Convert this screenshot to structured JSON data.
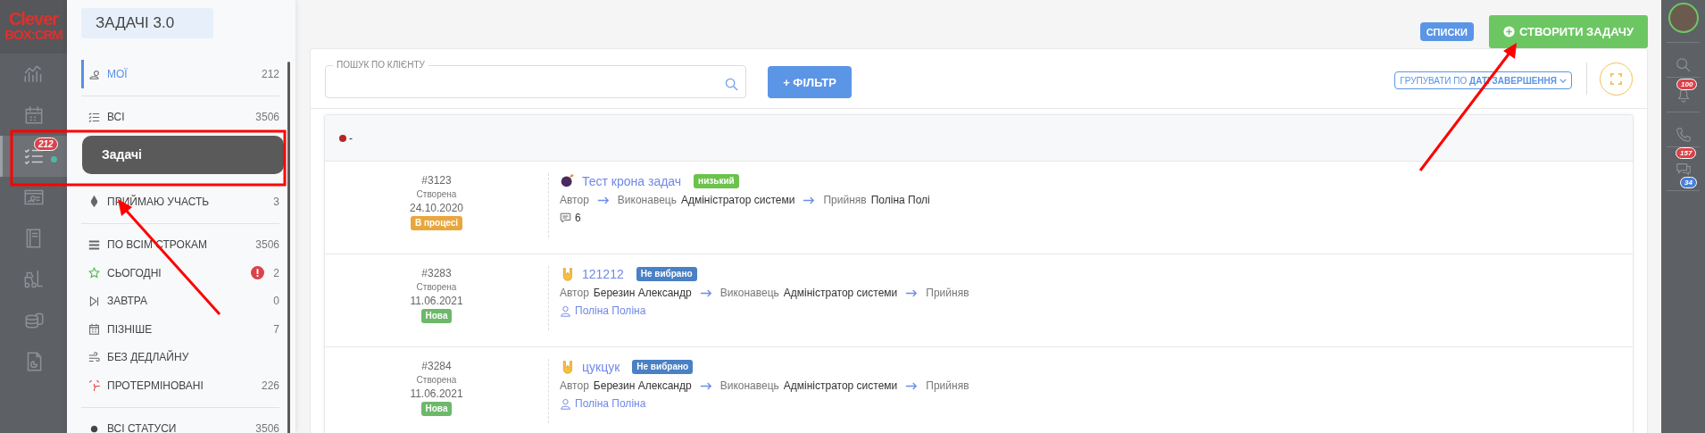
{
  "nav_rail": {
    "logo": {
      "line_1": "Clever",
      "line_2": "BOX:CRM"
    },
    "items": [
      {
        "selected": false
      },
      {
        "selected": false
      },
      {
        "selected": true,
        "badge": "212",
        "online": true
      },
      {
        "selected": false
      },
      {
        "selected": false
      },
      {
        "selected": false
      },
      {
        "selected": false
      },
      {
        "selected": false
      }
    ]
  },
  "tooltip": "Задачі",
  "menu": {
    "title": "ЗАДАЧІ 3.0",
    "groups": [
      [
        {
          "label": "МОЇ",
          "count": "212",
          "selected": true,
          "alert": false
        }
      ],
      [
        {
          "label": "ВСІ",
          "count": "3506",
          "selected": false,
          "alert": false
        },
        {
          "label": "ПРИЙМАЮ УЧАСТЬ",
          "count": "3",
          "selected": false,
          "alert": false
        }
      ],
      [
        {
          "label": "ПО ВСІМ СТРОКАМ",
          "count": "3506",
          "selected": false,
          "alert": false
        },
        {
          "label": "СЬОГОДНІ",
          "count": "2",
          "selected": false,
          "alert": true
        },
        {
          "label": "ЗАВТРА",
          "count": "0",
          "selected": false,
          "alert": false
        },
        {
          "label": "ПІЗНІШЕ",
          "count": "7",
          "selected": false,
          "alert": false
        },
        {
          "label": "БЕЗ ДЕДЛАЙНУ",
          "selected": false,
          "alert": false
        },
        {
          "label": "ПРОТЕРМІНОВАНІ",
          "count": "226",
          "selected": false,
          "alert": false
        }
      ],
      [
        {
          "label": "ВСІ СТАТУСИ",
          "count": "3506",
          "selected": false,
          "alert": false
        }
      ]
    ]
  },
  "header": {
    "lists_button": "СПИСКИ",
    "create_button": "СТВОРИТИ ЗАДАЧУ"
  },
  "toolbar": {
    "search": {
      "label": "ПОШУК ПО КЛІЄНТУ"
    },
    "filter_button": "+ ФІЛЬТР",
    "group_by": "ГРУПУВАТИ ПО **ДАТІ ЗАВЕРШЕННЯ**"
  },
  "group": {
    "color": "#b0282a",
    "title": "-",
    "tasks": [
      {
        "kind": "bomb",
        "number": "#3123",
        "created_label": "Створена",
        "date": "24.10.2020",
        "status": {
          "label": "В процесі",
          "color": "#e8a73e"
        },
        "title": "Тест крона задач",
        "priority": {
          "label": "низький",
          "color": "#6cc24a"
        },
        "parties": [
          {
            "role": "Автор"
          },
          {
            "role": "Виконавець",
            "name": "Адміністратор системи"
          },
          {
            "role": "Прийняв",
            "name": "Поліна Полі"
          }
        ],
        "footer": {
          "kind": "comments",
          "text": "6"
        }
      },
      {
        "kind": "hand",
        "number": "#3283",
        "created_label": "Створена",
        "date": "11.06.2021",
        "status": {
          "label": "Нова",
          "color": "#6db86a"
        },
        "title": "121212",
        "priority": {
          "label": "Не вибрано",
          "color": "#4a80c4"
        },
        "parties": [
          {
            "role": "Автор",
            "name": "Березин Александр"
          },
          {
            "role": "Виконавець",
            "name": "Адміністратор системи"
          },
          {
            "role": "Прийняв"
          }
        ],
        "footer": {
          "kind": "person",
          "text": "Поліна Поліна"
        }
      },
      {
        "kind": "hand",
        "number": "#3284",
        "created_label": "Створена",
        "date": "11.06.2021",
        "status": {
          "label": "Нова",
          "color": "#6db86a"
        },
        "title": "цукцук",
        "priority": {
          "label": "Не вибрано",
          "color": "#4a80c4"
        },
        "parties": [
          {
            "role": "Автор",
            "name": "Березин Александр"
          },
          {
            "role": "Виконавець",
            "name": "Адміністратор системи"
          },
          {
            "role": "Прийняв"
          }
        ],
        "footer": {
          "kind": "person",
          "text": "Поліна Поліна"
        }
      }
    ]
  },
  "right_rail": {
    "notifications_badge": "100",
    "chat_badges": [
      {
        "text": "157",
        "color": "#d9434a"
      },
      {
        "text": "34",
        "color": "#4a80d9"
      }
    ]
  }
}
